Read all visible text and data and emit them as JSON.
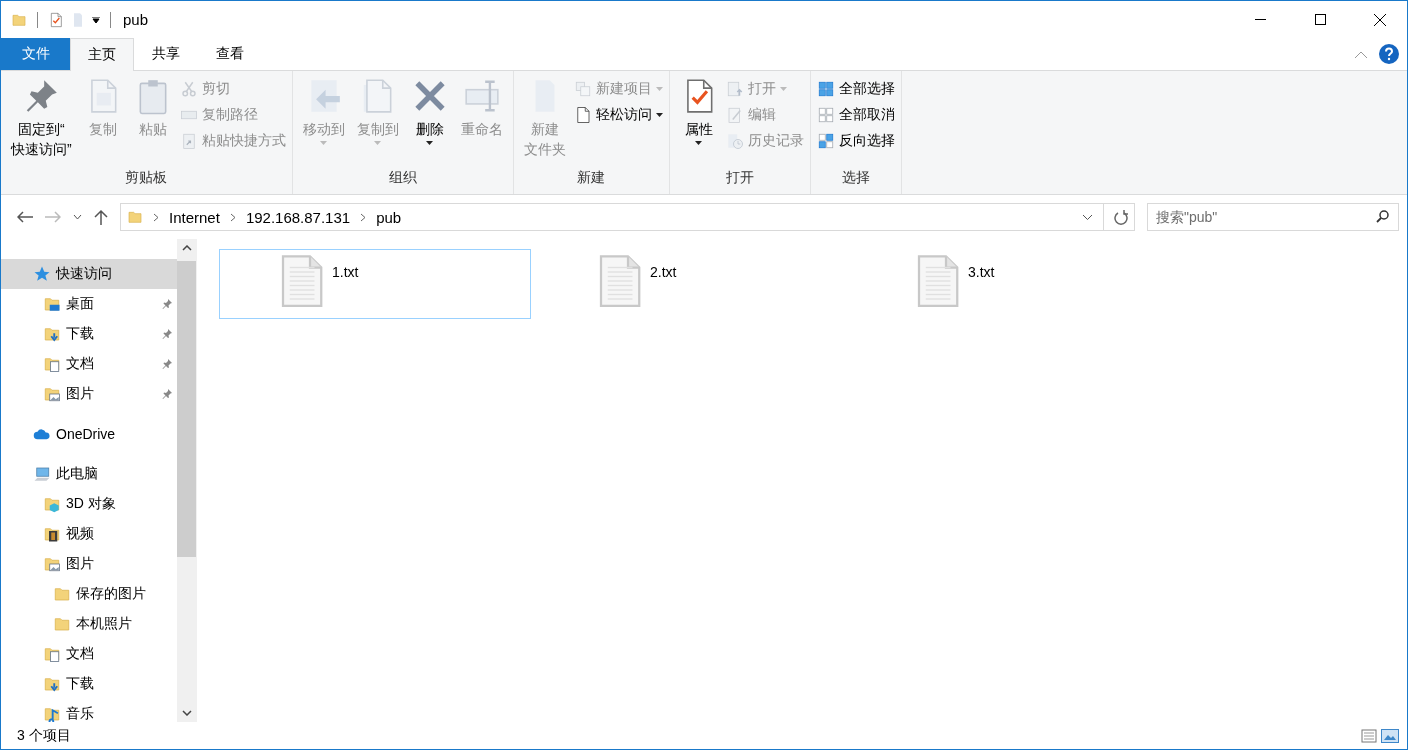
{
  "window": {
    "title": "pub"
  },
  "tabs": [
    {
      "label": "文件",
      "kind": "menu",
      "selected": false
    },
    {
      "label": "主页",
      "kind": "tab",
      "selected": true
    },
    {
      "label": "共享",
      "kind": "tab",
      "selected": false
    },
    {
      "label": "查看",
      "kind": "tab",
      "selected": false
    }
  ],
  "ribbon": [
    {
      "label": "剪贴板",
      "items": [
        {
          "kind": "large",
          "lines": [
            "固定到“",
            "快速访问”"
          ],
          "disabled": false,
          "dropdown": false
        },
        {
          "kind": "large",
          "lines": [
            "复制"
          ],
          "disabled": true,
          "dropdown": false
        },
        {
          "kind": "large",
          "lines": [
            "粘贴"
          ],
          "disabled": true,
          "dropdown": false
        },
        {
          "kind": "column",
          "items": [
            {
              "label": "剪切",
              "disabled": true,
              "dropdown": false
            },
            {
              "label": "复制路径",
              "disabled": true,
              "dropdown": false
            },
            {
              "label": "粘贴快捷方式",
              "disabled": true,
              "dropdown": false
            }
          ]
        }
      ]
    },
    {
      "label": "组织",
      "items": [
        {
          "kind": "large",
          "lines": [
            "移动到"
          ],
          "disabled": true,
          "dropdown": true
        },
        {
          "kind": "large",
          "lines": [
            "复制到"
          ],
          "disabled": true,
          "dropdown": true
        },
        {
          "kind": "large",
          "lines": [
            "删除"
          ],
          "disabled": false,
          "dropdown": true
        },
        {
          "kind": "large",
          "lines": [
            "重命名"
          ],
          "disabled": true,
          "dropdown": false
        }
      ]
    },
    {
      "label": "新建",
      "items": [
        {
          "kind": "large",
          "lines": [
            "新建",
            "文件夹"
          ],
          "disabled": true,
          "dropdown": false
        },
        {
          "kind": "column",
          "items": [
            {
              "label": "新建项目",
              "disabled": true,
              "dropdown": true
            },
            {
              "label": "轻松访问",
              "disabled": false,
              "dropdown": true
            }
          ]
        }
      ]
    },
    {
      "label": "打开",
      "items": [
        {
          "kind": "large",
          "lines": [
            "属性"
          ],
          "disabled": false,
          "dropdown": true
        },
        {
          "kind": "column",
          "items": [
            {
              "label": "打开",
              "disabled": true,
              "dropdown": true
            },
            {
              "label": "编辑",
              "disabled": true,
              "dropdown": false
            },
            {
              "label": "历史记录",
              "disabled": true,
              "dropdown": false
            }
          ]
        }
      ]
    },
    {
      "label": "选择",
      "items": [
        {
          "kind": "column",
          "items": [
            {
              "label": "全部选择",
              "disabled": false,
              "dropdown": false
            },
            {
              "label": "全部取消",
              "disabled": false,
              "dropdown": false
            },
            {
              "label": "反向选择",
              "disabled": false,
              "dropdown": false
            }
          ]
        }
      ]
    }
  ],
  "address": {
    "segments": [
      "Internet",
      "192.168.87.131",
      "pub"
    ]
  },
  "search": {
    "placeholder": "搜索\"pub\""
  },
  "sidebar": {
    "items": [
      {
        "label": "快速访问",
        "selected": true,
        "pinned": false,
        "children": [
          {
            "label": "桌面",
            "selected": false,
            "pinned": true
          },
          {
            "label": "下载",
            "selected": false,
            "pinned": true
          },
          {
            "label": "文档",
            "selected": false,
            "pinned": true
          },
          {
            "label": "图片",
            "selected": false,
            "pinned": true
          }
        ]
      },
      {
        "label": "OneDrive",
        "selected": false,
        "pinned": false
      },
      {
        "label": "此电脑",
        "selected": false,
        "pinned": false,
        "children": [
          {
            "label": "3D 对象",
            "selected": false,
            "pinned": false
          },
          {
            "label": "视频",
            "selected": false,
            "pinned": false
          },
          {
            "label": "图片",
            "selected": false,
            "pinned": false,
            "children": [
              {
                "label": "保存的图片",
                "selected": false,
                "pinned": false
              },
              {
                "label": "本机照片",
                "selected": false,
                "pinned": false
              }
            ]
          },
          {
            "label": "文档",
            "selected": false,
            "pinned": false
          },
          {
            "label": "下载",
            "selected": false,
            "pinned": false
          },
          {
            "label": "音乐",
            "selected": false,
            "pinned": false
          }
        ]
      }
    ]
  },
  "files": [
    {
      "name": "1.txt",
      "selected": true
    },
    {
      "name": "2.txt",
      "selected": false
    },
    {
      "name": "3.txt",
      "selected": false
    }
  ],
  "status_bar": {
    "text": "3 个项目"
  }
}
